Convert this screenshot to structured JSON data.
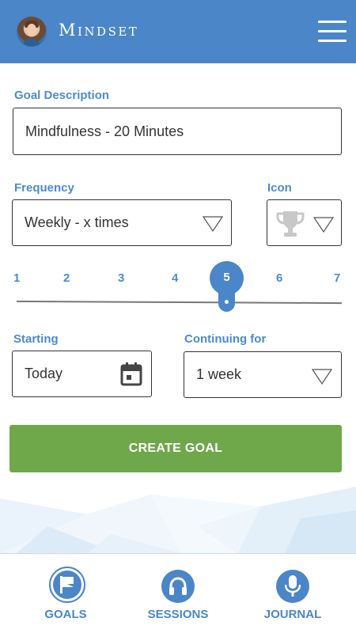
{
  "app": {
    "brand": "Mindset"
  },
  "form": {
    "goal_description": {
      "label": "Goal Description",
      "value": "Mindfulness - 20 Minutes"
    },
    "frequency": {
      "label": "Frequency",
      "value": "Weekly - x times"
    },
    "icon": {
      "label": "Icon",
      "value_icon": "trophy-icon"
    },
    "times_per_week": {
      "ticks": [
        "1",
        "2",
        "3",
        "4",
        "5",
        "6",
        "7"
      ],
      "selected": "5"
    },
    "starting": {
      "label": "Starting",
      "value": "Today"
    },
    "continuing_for": {
      "label": "Continuing for",
      "value": "1 week"
    },
    "create_button": "CREATE GOAL"
  },
  "nav": {
    "goals": "GOALS",
    "sessions": "SESSIONS",
    "journal": "JOURNAL",
    "active": "goals"
  },
  "colors": {
    "primary": "#4a86c8",
    "label": "#4a8ccf",
    "button": "#6ea84a"
  }
}
